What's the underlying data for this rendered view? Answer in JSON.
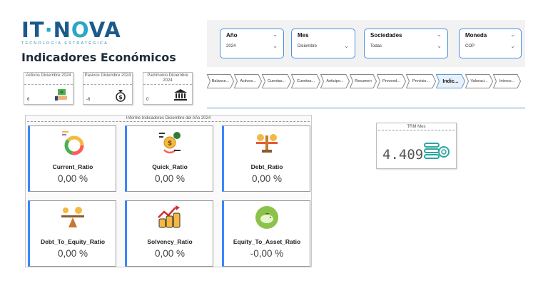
{
  "logo": {
    "main_a": "IT",
    "main_b": "N",
    "main_c": "VA",
    "sub": "TECNOLOGÍA ESTRATÉGICA"
  },
  "page_title": "Indicadores Económicos",
  "filters": [
    {
      "label": "Año",
      "value": "2024"
    },
    {
      "label": "Mes",
      "value": "Diciembre"
    },
    {
      "label": "Sociedades",
      "value": "Todas"
    },
    {
      "label": "Moneda",
      "value": "COP"
    }
  ],
  "kpis": [
    {
      "title": "Activos Diciembre 2024",
      "value": "6",
      "icon": "hand-money-icon"
    },
    {
      "title": "Pasivos Diciembre 2024",
      "value": "-6",
      "icon": "money-bag-icon"
    },
    {
      "title": "Patrimonio Diciembre 2024",
      "value": "0",
      "icon": "bank-icon"
    }
  ],
  "nav_tabs": [
    "Balance...",
    "Activos...",
    "Cuentas...",
    "Cuentas...",
    "Anticipo...",
    "Resumen",
    "Proveed...",
    "Provisio...",
    "Indic...",
    "Valoraci...",
    "Interco..."
  ],
  "active_tab": "Indic...",
  "panel_title": "Informe Indicadores Diciembre del Año 2024",
  "ratios": [
    {
      "label": "Current_Ratio",
      "value": "0,00 %"
    },
    {
      "label": "Quick_Ratio",
      "value": "0,00 %"
    },
    {
      "label": "Debt_Ratio",
      "value": "0,00 %"
    },
    {
      "label": "Debt_To_Equity_Ratio",
      "value": "0,00 %"
    },
    {
      "label": "Solvency_Ratio",
      "value": "0,00 %"
    },
    {
      "label": "Equity_To_Asset_Ratio",
      "value": "-0,00 %"
    }
  ],
  "trm": {
    "title": "TRM Mes",
    "value": "4.409"
  },
  "colors": {
    "accent": "#3a86ff",
    "brand": "#1b5a8a",
    "brand_light": "#2aa6c8",
    "divider": "#5b9bd5"
  }
}
